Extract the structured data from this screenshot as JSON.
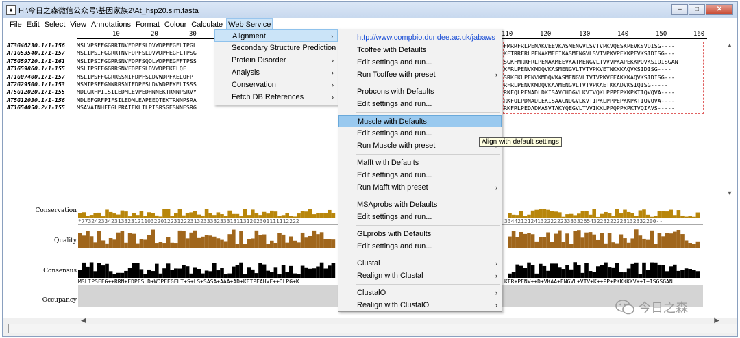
{
  "window": {
    "title": "H:\\今日之森微信公众号\\基因家族2\\At_hsp20.sim.fasta",
    "icon": "jalview-window-icon",
    "controls": {
      "minimize": "–",
      "maximize": "□",
      "close": "✕"
    }
  },
  "menubar": {
    "items": [
      "File",
      "Edit",
      "Select",
      "View",
      "Annotations",
      "Format",
      "Colour",
      "Calculate",
      "Web Service"
    ],
    "active": "Web Service"
  },
  "ruler": {
    "ticks": [
      "10",
      "20",
      "30",
      "110",
      "120",
      "130",
      "140",
      "150",
      "160"
    ]
  },
  "sequences": {
    "names": [
      "AT3G46230.1/1-156",
      "AT1G53540.1/1-157",
      "AT5G59720.1/1-161",
      "AT1G59860.1/1-155",
      "AT1G07400.1/1-157",
      "AT2G29500.1/1-153",
      "AT5G12020.1/1-155",
      "AT5G12030.1/1-156",
      "AT1G54050.2/1-155"
    ],
    "left_residues": [
      "MSLVPSFFGGRRTNVFDPFSLDVWDPFEGFLTPGL",
      "MSLIPSIFGGRRTNVFDPFSLDVWDPFEGFLTPSG",
      "MSLIPSIFGGRRSNVFDPFSQDLWDPFEGFFTPSS",
      "MSLIPSFFGGRRSNVFDPFSLDVWDPFKELQF",
      "MSLIPSFFGGRRSSNIFDPFSLDVWDPFKELQFP",
      "MSMIPSFFGNNRRSNIFDPFSLDVWDPFKELTSSS",
      "MDLGRFPIISILEDMLEVPEDHNNEKTRNNPSRVY",
      "MDLEFGRFPIFSILEDMLEAPEEQTEKTRNNPSRA",
      "MSAVAINHFFGLPRAIEKLILPISRSGESNNESRG"
    ],
    "right_residues": [
      "FMRRFRLPENAKVEEVKASMENGVLSVTVPKVQESKPEVKSVDISG----",
      "KFTRRFRLPENAKMEEIKASMENGVLSVTVPKVPEKKPEVKSIDISG---",
      "SGKFMRRFRLPENAKMEEVKATMENGVLTVVVPKAPEKKPQVKSIDISGAN",
      "KFRLPENVKMDQVKASMENGVLTVTVPKVETNKKKAQVKSIDISG----",
      "SRKFKLPENVKMDQVKASMENGVLTVTVPKVEEAKKKAQVKSIDISG---",
      "RFRLPENVKMDQVKAAMENGVLTVTVPKAETKKADVKSIQISG-----",
      "RKFQLPENADLDKISAVCHDGVLKVTVQKLPPPEPKKPKTIQVQVA----",
      "RKFQLPDNADLEKISAACNDGVLKVTIPKLPPPEPKKPKTIQVQVA----",
      "RKFRLPEDADMASVTAKYQEGVLTVVIKKLPPQPPKPKTVQIAVS-----"
    ]
  },
  "annotations": {
    "labels": [
      "Conservation",
      "Quality",
      "Consensus",
      "Occupancy"
    ],
    "conservation_numbers_left": "*773242334231332312110322012231222313233332333131131202301111112222",
    "conservation_numbers_right": "3344212124132222223333326543223222223132332200--",
    "consensus_left": "MSLIPSFFG++RRN+FDPFSLD+WDPFEGFLT+S+LS+SASA+AAA+AD+KETPEAHVF++DLPG+K",
    "consensus_right": "KFR+PENV++D+VKAA+ENGVL+VTV+K++PP+PKKKKKV++I+ISGSGAN"
  },
  "submenu_web_service": {
    "items": [
      {
        "label": "Alignment",
        "highlight": true
      },
      {
        "label": "Secondary Structure Prediction"
      },
      {
        "label": "Protein Disorder"
      },
      {
        "label": "Analysis"
      },
      {
        "label": "Conservation"
      },
      {
        "label": "Fetch DB References"
      }
    ]
  },
  "submenu_alignment": {
    "url": "http://www.compbio.dundee.ac.uk/jabaws",
    "groups": [
      [
        "Tcoffee  with Defaults",
        "Edit settings and run...",
        "Run Tcoffee  with preset"
      ],
      [
        "Probcons  with Defaults",
        "Edit settings and run..."
      ],
      [
        "Muscle  with Defaults",
        "Edit settings and run...",
        "Run Muscle  with preset"
      ],
      [
        "Mafft  with Defaults",
        "Edit settings and run...",
        "Run Mafft  with preset"
      ],
      [
        "MSAprobs  with Defaults",
        "Edit settings and run..."
      ],
      [
        "GLprobs  with Defaults",
        "Edit settings and run..."
      ],
      [
        "Clustal",
        "Realign with Clustal"
      ],
      [
        "ClustalO",
        "Realign with ClustalO"
      ]
    ],
    "highlighted": "Muscle  with Defaults"
  },
  "tooltip": "Align  with default settings",
  "watermark": "今日之森",
  "colors": {
    "conservation_bar": "#b8860b",
    "quality_bar": "#a0661c",
    "consensus_bar": "#000000",
    "occupancy": "#d4d4d4",
    "highlight": "#99c9ef",
    "url": "#1a4ed6"
  }
}
